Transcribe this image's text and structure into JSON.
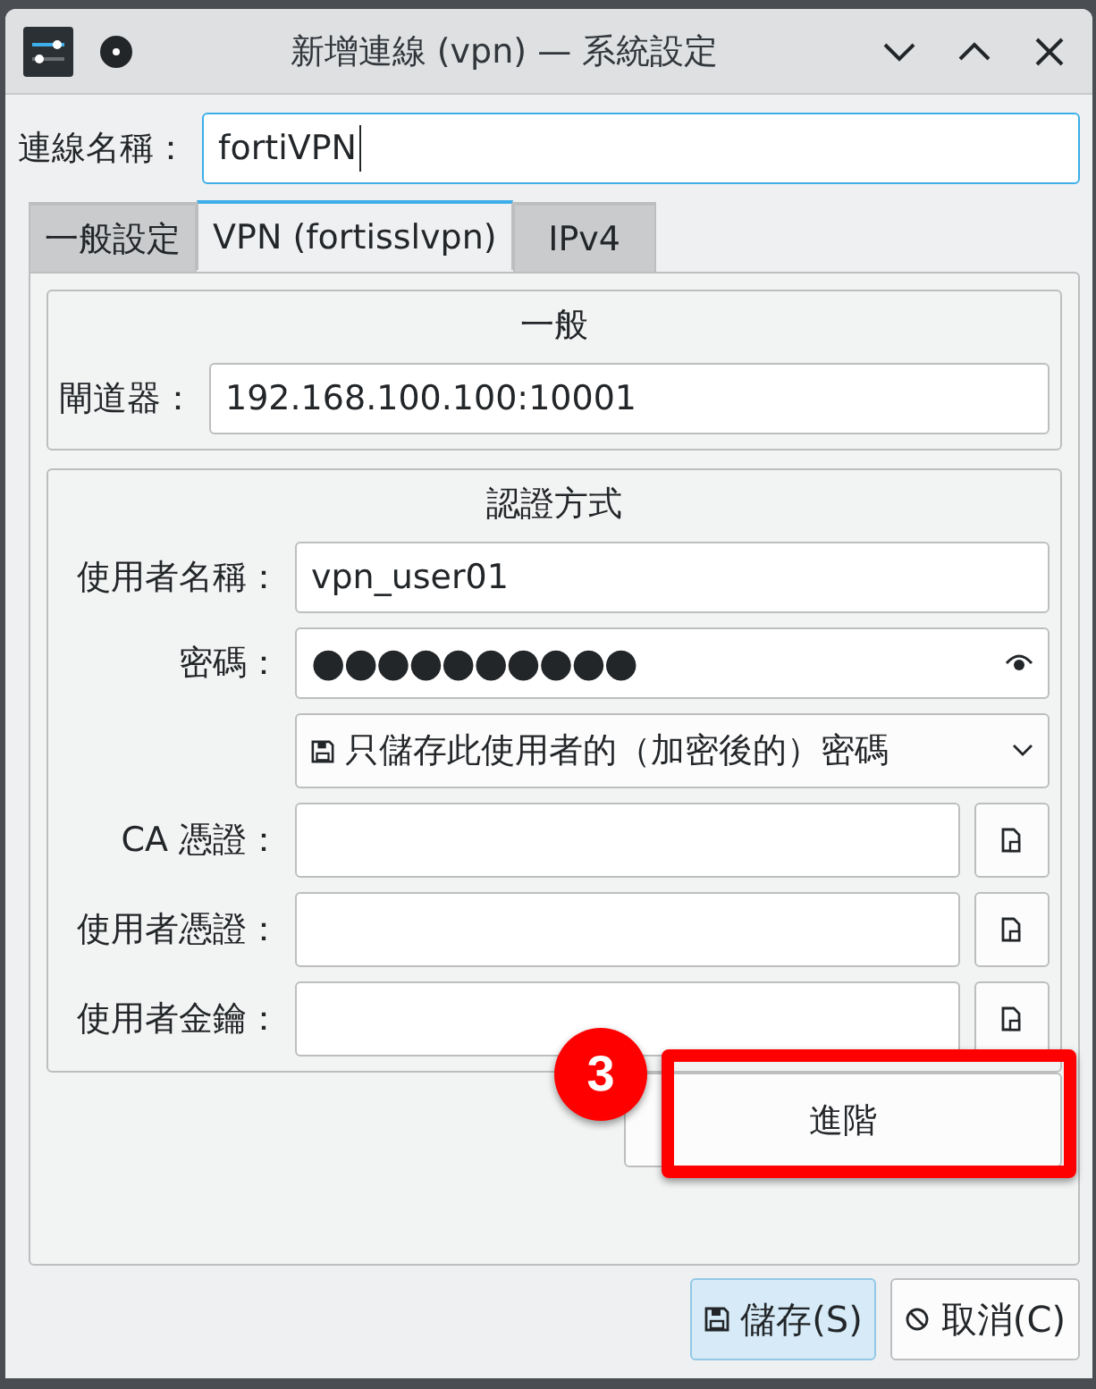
{
  "window": {
    "title": "新增連線 (vpn) — 系統設定"
  },
  "connection_name": {
    "label": "連線名稱：",
    "value": "fortiVPN"
  },
  "tabs": [
    {
      "label": "一般設定",
      "selected": false
    },
    {
      "label": "VPN (fortisslvpn)",
      "selected": true
    },
    {
      "label": "IPv4",
      "selected": false
    }
  ],
  "general": {
    "heading": "一般",
    "gateway": {
      "label": "閘道器：",
      "value": "192.168.100.100:10001"
    }
  },
  "authentication": {
    "heading": "認證方式",
    "username": {
      "label": "使用者名稱：",
      "value": "vpn_user01"
    },
    "password": {
      "label": "密碼：",
      "value": "●●●●●●●●●●"
    },
    "password_storage": {
      "value": "只儲存此使用者的（加密後的）密碼"
    },
    "certificates": [
      {
        "label": "CA 憑證："
      },
      {
        "label": "使用者憑證："
      },
      {
        "label": "使用者金鑰："
      }
    ]
  },
  "advanced_button": {
    "label": "進階"
  },
  "annotation": {
    "number": "3"
  },
  "buttons": [
    {
      "label": "儲存(S)",
      "kind": "save",
      "focused": true
    },
    {
      "label": "取消(C)",
      "kind": "cancel",
      "focused": false
    }
  ]
}
